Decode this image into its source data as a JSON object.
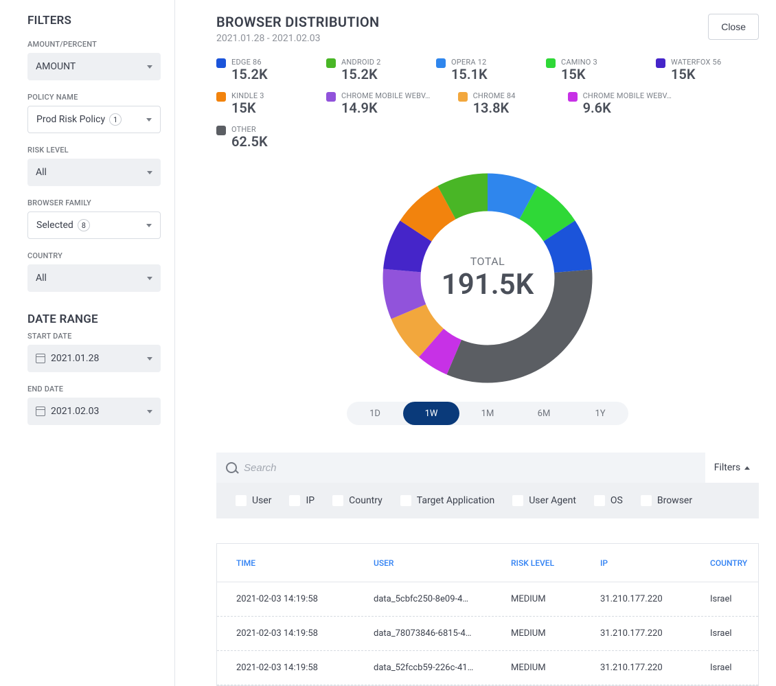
{
  "sidebar": {
    "filters_title": "FILTERS",
    "amount_percent": {
      "label": "AMOUNT/PERCENT",
      "value": "AMOUNT"
    },
    "policy_name": {
      "label": "POLICY NAME",
      "value": "Prod Risk Policy",
      "count": "1"
    },
    "risk_level": {
      "label": "RISK LEVEL",
      "value": "All"
    },
    "browser_family": {
      "label": "BROWSER FAMILY",
      "value": "Selected",
      "count": "8"
    },
    "country": {
      "label": "COUNTRY",
      "value": "All"
    },
    "date_range_title": "DATE RANGE",
    "start_date": {
      "label": "START DATE",
      "value": "2021.01.28"
    },
    "end_date": {
      "label": "END DATE",
      "value": "2021.02.03"
    }
  },
  "header": {
    "title": "BROWSER DISTRIBUTION",
    "date_range": "2021.01.28 - 2021.02.03",
    "close": "Close"
  },
  "chart_data": {
    "type": "pie",
    "title": "BROWSER DISTRIBUTION",
    "total_label": "TOTAL",
    "total_value": "191.5K",
    "series": [
      {
        "name": "EDGE 86",
        "value_label": "15.2K",
        "value": 15200,
        "color": "#1b54da"
      },
      {
        "name": "ANDROID 2",
        "value_label": "15.2K",
        "value": 15200,
        "color": "#49b626"
      },
      {
        "name": "OPERA 12",
        "value_label": "15.1K",
        "value": 15100,
        "color": "#2f86ed"
      },
      {
        "name": "CAMINO 3",
        "value_label": "15K",
        "value": 15000,
        "color": "#2fd837"
      },
      {
        "name": "WATERFOX 56",
        "value_label": "15K",
        "value": 15000,
        "color": "#4525c9"
      },
      {
        "name": "KINDLE 3",
        "value_label": "15K",
        "value": 15000,
        "color": "#f2830d"
      },
      {
        "name": "CHROME MOBILE WEBV…",
        "value_label": "14.9K",
        "value": 14900,
        "color": "#9153db"
      },
      {
        "name": "CHROME 84",
        "value_label": "13.8K",
        "value": 13800,
        "color": "#f2a73d"
      },
      {
        "name": "CHROME MOBILE WEBV…",
        "value_label": "9.6K",
        "value": 9600,
        "color": "#c731e6"
      },
      {
        "name": "OTHER",
        "value_label": "62.5K",
        "value": 62500,
        "color": "#5b5e63"
      }
    ]
  },
  "range_options": [
    "1D",
    "1W",
    "1M",
    "6M",
    "1Y"
  ],
  "range_active": "1W",
  "search": {
    "placeholder": "Search",
    "filters_label": "Filters",
    "chips": [
      "User",
      "IP",
      "Country",
      "Target Application",
      "User Agent",
      "OS",
      "Browser"
    ]
  },
  "table": {
    "columns": [
      "TIME",
      "USER",
      "RISK LEVEL",
      "IP",
      "COUNTRY"
    ],
    "rows": [
      {
        "time": "2021-02-03 14:19:58",
        "user": "data_5cbfc250-8e09-4…",
        "risk": "MEDIUM",
        "ip": "31.210.177.220",
        "country": "Israel"
      },
      {
        "time": "2021-02-03 14:19:58",
        "user": "data_78073846-6815-4…",
        "risk": "MEDIUM",
        "ip": "31.210.177.220",
        "country": "Israel"
      },
      {
        "time": "2021-02-03 14:19:58",
        "user": "data_52fccb59-226c-41…",
        "risk": "MEDIUM",
        "ip": "31.210.177.220",
        "country": "Israel"
      }
    ]
  }
}
